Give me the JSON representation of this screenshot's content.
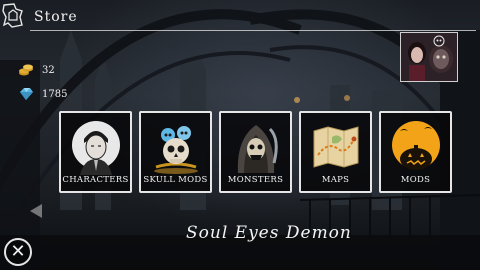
{
  "header": {
    "title": "Store",
    "home_icon": "home-icon"
  },
  "currencies": [
    {
      "name": "gold",
      "icon": "gold-coins-icon",
      "value": "32",
      "color": "#d8a62a"
    },
    {
      "name": "gems",
      "icon": "gem-icon",
      "value": "1785",
      "color": "#5fb9e6"
    }
  ],
  "store_items": [
    {
      "label": "Characters",
      "icon": "character-icon"
    },
    {
      "label": "Skull Mods",
      "icon": "skulls-icon"
    },
    {
      "label": "Monsters",
      "icon": "monster-icon"
    },
    {
      "label": "Maps",
      "icon": "map-icon"
    },
    {
      "label": "Mods",
      "icon": "pumpkin-icon"
    }
  ],
  "selected_name": "Soul Eyes Demon",
  "colors": {
    "card_border": "#e6e6e6",
    "card_bg": "#08080a",
    "mods_orange": "#f2a318"
  }
}
